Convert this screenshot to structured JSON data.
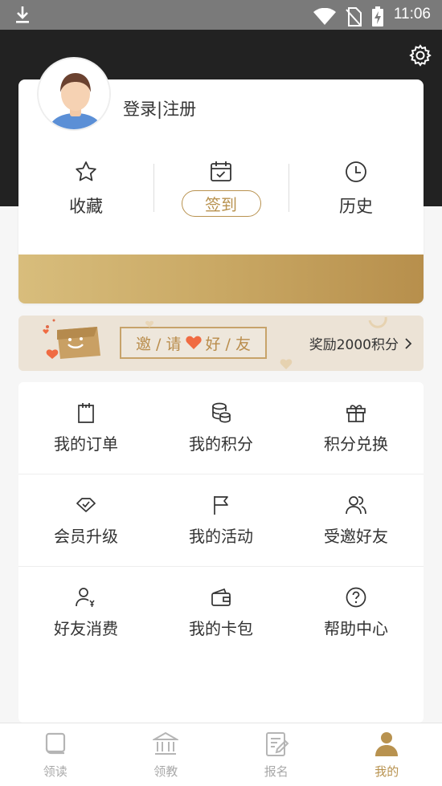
{
  "status_bar": {
    "time": "11:06",
    "icons": [
      "download-icon",
      "wifi-icon",
      "no-sim-icon",
      "battery-charging-icon"
    ]
  },
  "header": {
    "settings_icon": "gear-icon"
  },
  "profile": {
    "login_label": "登录|注册"
  },
  "quick_actions": [
    {
      "label": "收藏",
      "icon": "star-icon"
    },
    {
      "label": "签到",
      "icon": "calendar-check-icon"
    },
    {
      "label": "历史",
      "icon": "clock-icon"
    }
  ],
  "invite": {
    "text_a": "邀 / 请",
    "text_b": "好 / 友",
    "reward": "奖励2000积分"
  },
  "menu": [
    {
      "label": "我的订单",
      "icon": "order-icon"
    },
    {
      "label": "我的积分",
      "icon": "coins-icon"
    },
    {
      "label": "积分兑换",
      "icon": "gift-icon"
    },
    {
      "label": "会员升级",
      "icon": "diamond-icon"
    },
    {
      "label": "我的活动",
      "icon": "flag-icon"
    },
    {
      "label": "受邀好友",
      "icon": "friends-icon"
    },
    {
      "label": "好友消费",
      "icon": "user-yuan-icon"
    },
    {
      "label": "我的卡包",
      "icon": "wallet-icon"
    },
    {
      "label": "帮助中心",
      "icon": "help-icon"
    }
  ],
  "tabs": [
    {
      "label": "领读",
      "icon": "book-icon"
    },
    {
      "label": "领教",
      "icon": "institution-icon"
    },
    {
      "label": "报名",
      "icon": "signup-form-icon"
    },
    {
      "label": "我的",
      "icon": "person-icon"
    }
  ],
  "colors": {
    "accent": "#b8924f",
    "header_bg": "#222222",
    "tab_inactive": "#a9a9a9"
  }
}
